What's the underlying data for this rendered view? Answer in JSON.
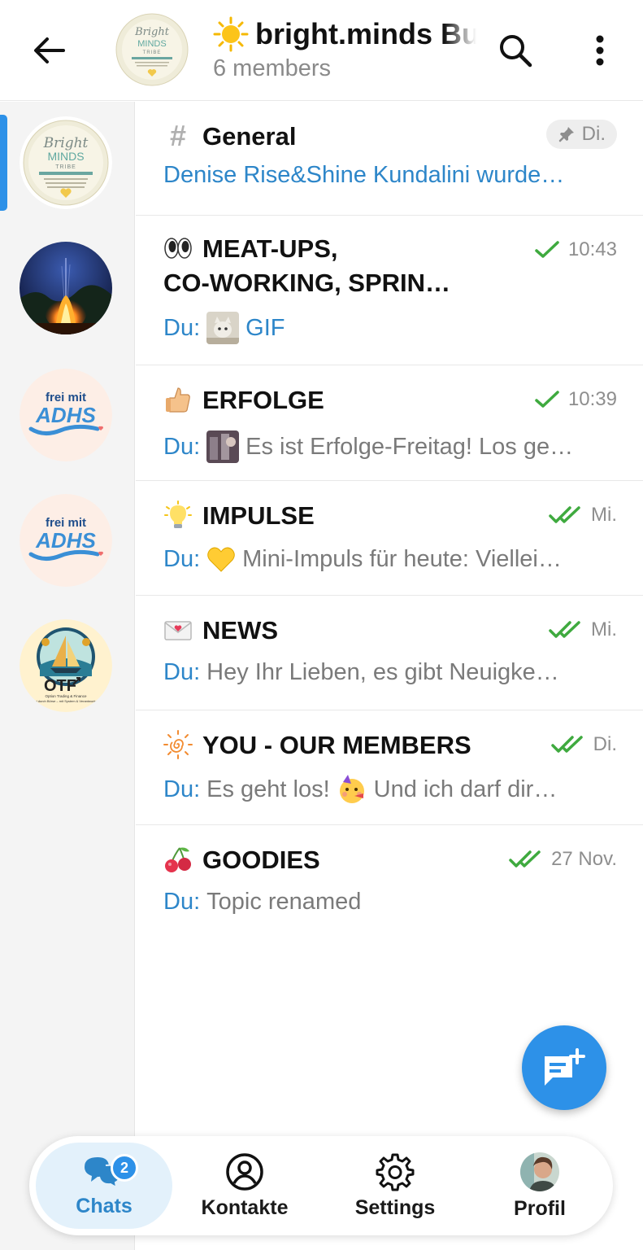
{
  "header": {
    "title": "bright.minds Bu",
    "subtitle": "6 members",
    "icons": {
      "back": "arrow-left-icon",
      "search": "search-icon",
      "menu": "more-vert-icon"
    }
  },
  "sidebar": {
    "communities": [
      {
        "name": "bright-minds-tribe-avatar",
        "text": [
          "Bright",
          "MINDS",
          "TRIBE"
        ]
      },
      {
        "name": "campfire-avatar"
      },
      {
        "name": "frei-mit-adhs-avatar",
        "text": [
          "frei mit",
          "ADHS"
        ]
      },
      {
        "name": "frei-mit-adhs-avatar",
        "text": [
          "frei mit",
          "ADHS"
        ]
      },
      {
        "name": "otf-avatar",
        "text": [
          "OTF",
          "Option Trading & Finance",
          "Frei durch Börse – mit System & Verantwortung"
        ]
      }
    ]
  },
  "topics": [
    {
      "title": "General",
      "time": "Di.",
      "pinned": true,
      "preview_prefix": "",
      "preview": "Denise Rise&Shine Kundalini wurde…"
    },
    {
      "title_lines": [
        "MEAT-UPS,",
        "CO-WORKING, SPRIN…"
      ],
      "time": "10:43",
      "preview_prefix": "Du:",
      "preview": "GIF"
    },
    {
      "title": "ERFOLGE",
      "time": "10:39",
      "preview_prefix": "Du:",
      "preview": "Es ist Erfolge-Freitag! Los ge…"
    },
    {
      "title": "IMPULSE",
      "time": "Mi.",
      "preview_prefix": "Du:",
      "preview": "Mini-Impuls für heute:  Viellei…"
    },
    {
      "title": "NEWS",
      "time": "Mi.",
      "preview_prefix": "Du:",
      "preview": "Hey Ihr Lieben,   es gibt Neuigke…"
    },
    {
      "title": "YOU - OUR MEMBERS",
      "time": "Di.",
      "preview_prefix": "Du:",
      "preview": "Es geht los!",
      "preview_after": "Und ich darf dir…"
    },
    {
      "title": "GOODIES",
      "time": "27 Nov.",
      "preview_prefix": "Du:",
      "preview": "Topic renamed"
    }
  ],
  "nav": {
    "chats": "Chats",
    "chats_badge": "2",
    "contacts": "Kontakte",
    "settings": "Settings",
    "profile": "Profil"
  },
  "colors": {
    "accent": "#2d91e8",
    "link": "#2d86c9",
    "check": "#3faa3f"
  }
}
